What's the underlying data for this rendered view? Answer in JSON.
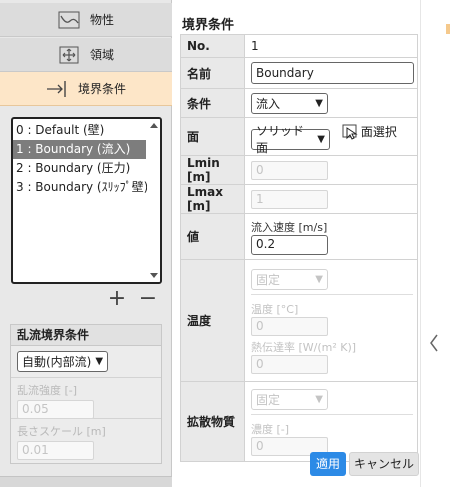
{
  "sidebar": {
    "nav": [
      {
        "label": "物性",
        "icon": "chart-icon"
      },
      {
        "label": "領域",
        "icon": "domain-icon"
      },
      {
        "label": "境界条件",
        "icon": "boundary-arrow-icon"
      }
    ],
    "boundary_list": [
      "0 : Default (壁)",
      "1 : Boundary (流入)",
      "2 : Boundary (圧力)",
      "3 : Boundary (ｽﾘｯﾌﾟ壁)"
    ],
    "selected_index": 1,
    "add_label": "+",
    "remove_label": "−",
    "turbulence": {
      "title": "乱流境界条件",
      "mode": "自動(内部流)",
      "intensity_label": "乱流強度 [-]",
      "intensity_value": "0.05",
      "length_label": "長さスケール [m]",
      "length_value": "0.01"
    }
  },
  "panel": {
    "title": "境界条件",
    "no_label": "No.",
    "no_value": "1",
    "name_label": "名前",
    "name_value": "Boundary",
    "condition_label": "条件",
    "condition_value": "流入",
    "face_label": "面",
    "face_value": "ソリッド面",
    "face_select_label": "面選択",
    "lmin_label": "Lmin [m]",
    "lmin_value": "0",
    "lmax_label": "Lmax [m]",
    "lmax_value": "1",
    "value_label": "値",
    "velocity_label": "流入速度 [m/s]",
    "velocity_value": "0.2",
    "temperature_label": "温度",
    "temp_mode": "固定",
    "temp_value_label": "温度 [°C]",
    "temp_value": "0",
    "heat_transfer_label": "熱伝達率 [W/(m² K)]",
    "heat_transfer_value": "0",
    "diffusion_label": "拡散物質",
    "diff_mode": "固定",
    "conc_label": "濃度 [-]",
    "conc_value": "0"
  },
  "buttons": {
    "apply": "適用",
    "cancel": "キャンセル"
  },
  "collapse_icon": "chevron-left-icon",
  "colors": {
    "active_nav": "#fde6c8",
    "apply": "#2c8ae6",
    "selected_row": "#7d7d7d"
  }
}
